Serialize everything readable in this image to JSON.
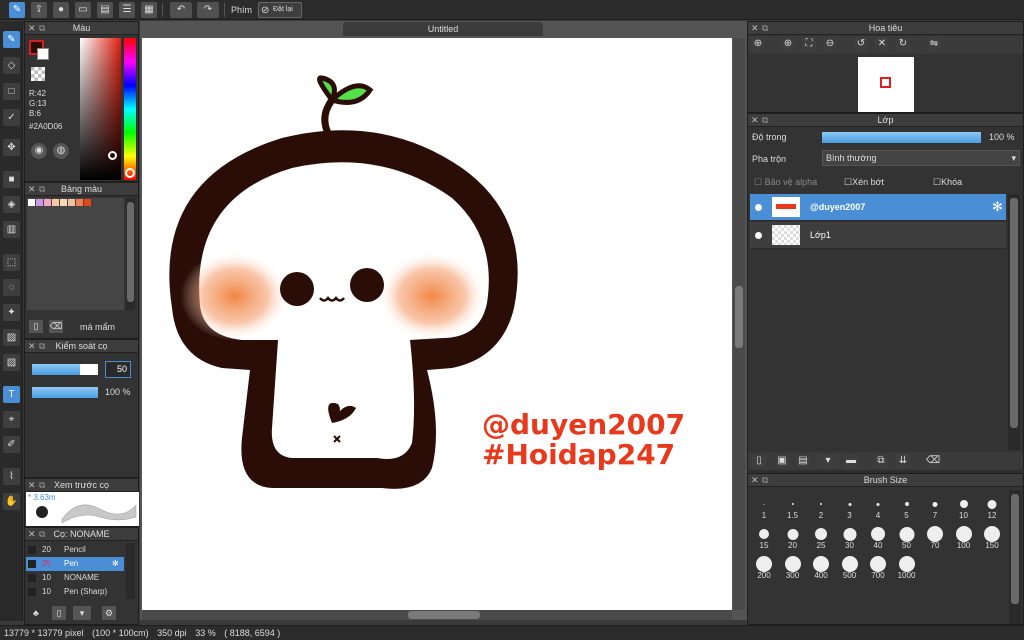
{
  "topbar": {
    "icons": [
      "brush-settings-icon",
      "share-icon",
      "chat-icon",
      "message-icon",
      "document-icon",
      "list-icon",
      "layout-icon"
    ],
    "undo_icon": "undo-icon",
    "redo_icon": "redo-icon",
    "shortcut_label": "Phím",
    "reset_label": "Đặt lại"
  },
  "document": {
    "title": "Untitled"
  },
  "color_panel": {
    "title": "Màu",
    "r": "R:42",
    "g": "G:13",
    "b": "B:6",
    "hex": "#2A0D06",
    "fg_color": "#2A0D06",
    "bg_color": "#ffffff"
  },
  "palette_panel": {
    "title": "Bảng màu",
    "swatches": [
      "#ffffff",
      "#c89be8",
      "#f4a8c8",
      "#f6c8a0",
      "#f6d8b8",
      "#f0c0a0",
      "#f08050",
      "#e04818"
    ],
    "palette_name": "má mẩm"
  },
  "brush_control": {
    "title": "Kiểm soát cọ",
    "size_value": "50",
    "opacity_value": "100 %"
  },
  "brush_preview": {
    "title": "Xem trước cọ",
    "size_text": "* 3.63m"
  },
  "brush_list": {
    "title": "Cọ: NONAME",
    "items": [
      {
        "size": "20",
        "name": "Pencil"
      },
      {
        "size": "25",
        "name": "Pen"
      },
      {
        "size": "10",
        "name": "NONAME"
      },
      {
        "size": "10",
        "name": "Pen (Sharp)"
      }
    ]
  },
  "canvas_text": {
    "line1": "@duyen2007",
    "line2": "#Hoidap247",
    "color": "#e8391c"
  },
  "navigator": {
    "title": "Hoa tiêu"
  },
  "layers_panel": {
    "title": "Lớp",
    "opacity_label": "Độ trong",
    "opacity_value": "100 %",
    "blend_label": "Pha trộn",
    "blend_value": "Bình thường",
    "protect_alpha": "Bảo vệ alpha",
    "clipping": "Xén bớt",
    "lock": "Khóa",
    "layers": [
      {
        "name": "@duyen2007"
      },
      {
        "name": "Lớp1"
      }
    ]
  },
  "brush_size_panel": {
    "title": "Brush Size",
    "sizes": [
      "1",
      "1.5",
      "2",
      "3",
      "4",
      "5",
      "7",
      "10",
      "12",
      "15",
      "20",
      "25",
      "30",
      "40",
      "50",
      "70",
      "100",
      "150",
      "200",
      "300",
      "400",
      "500",
      "700",
      "1000"
    ]
  },
  "status": {
    "pixels": "13779 * 13779 pixel",
    "cm": "(100 * 100cm)",
    "dpi": "350 dpi",
    "zoom": "33 %",
    "coords": "( 8188, 6594 )"
  }
}
